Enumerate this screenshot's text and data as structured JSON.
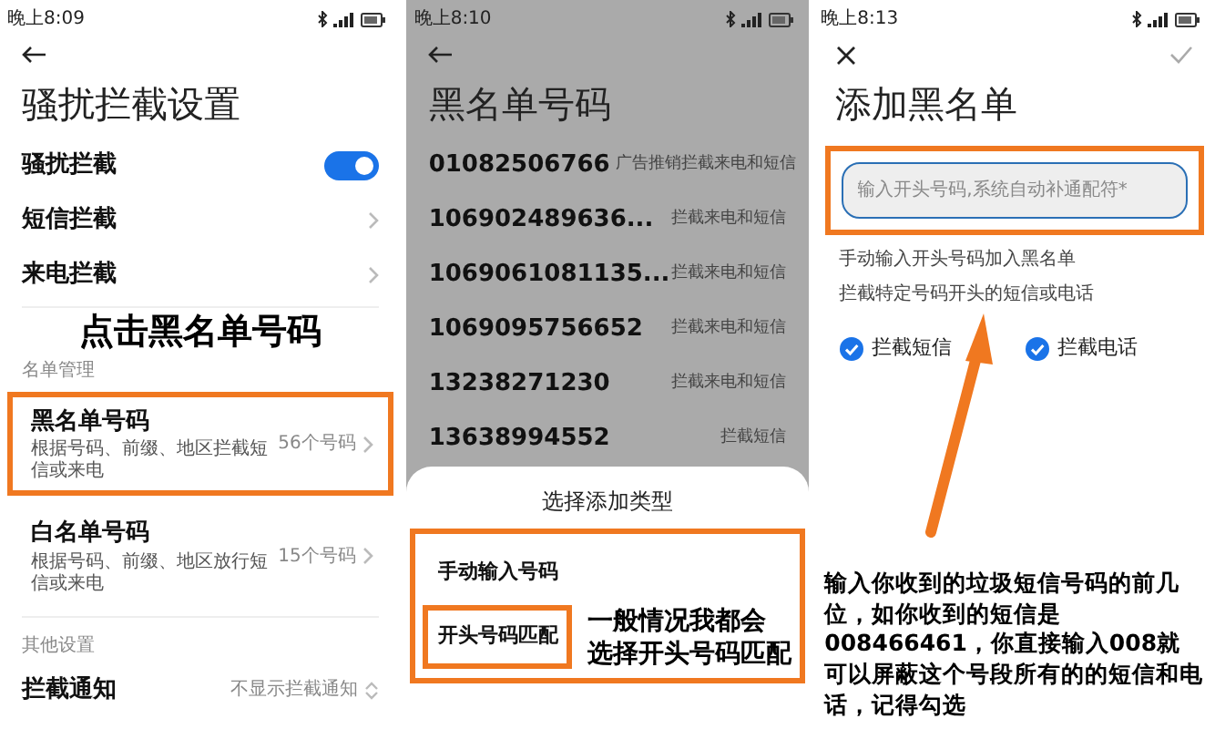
{
  "settings_screen": {
    "status_time": "晚上8:09",
    "title": "骚扰拦截设置",
    "rows": [
      {
        "kind": "toggle",
        "label": "骚扰拦截",
        "on": true
      },
      {
        "kind": "link",
        "label": "短信拦截"
      },
      {
        "kind": "link",
        "label": "来电拦截"
      }
    ],
    "annotation": "点击黑名单号码",
    "list_section": {
      "heading": "名单管理",
      "items": [
        {
          "label": "黑名单号码",
          "description": "根据号码、前缀、地区拦截短信或来电",
          "count": "56个号码",
          "highlighted": true
        },
        {
          "label": "白名单号码",
          "description": "根据号码、前缀、地区放行短信或来电",
          "count": "15个号码",
          "highlighted": false
        }
      ]
    },
    "other_section": {
      "heading": "其他设置",
      "items": [
        {
          "label": "拦截通知",
          "value": "不显示拦截通知"
        }
      ]
    }
  },
  "blacklist_screen": {
    "status_time": "晚上8:10",
    "title": "黑名单号码",
    "entries": [
      {
        "number": "01082506766",
        "tag": "广告推销",
        "action": "拦截来电和短信"
      },
      {
        "number": "106902489636...",
        "action": "拦截来电和短信"
      },
      {
        "number": "1069061081135...",
        "action": "拦截来电和短信"
      },
      {
        "number": "1069095756652",
        "action": "拦截来电和短信"
      },
      {
        "number": "13238271230",
        "action": "拦截来电和短信"
      },
      {
        "number": "13638994552",
        "action": "拦截短信"
      }
    ],
    "sheet": {
      "title": "选择添加类型",
      "framed": true,
      "options": [
        {
          "label": "手动输入号码",
          "highlighted": false
        },
        {
          "label": "开头号码匹配",
          "highlighted": true
        }
      ],
      "annotation": [
        "一般情况我都会",
        "选择开头号码匹配"
      ]
    }
  },
  "add_screen": {
    "status_time": "晚上8:13",
    "title": "添加黑名单",
    "input": {
      "placeholder": "输入开头号码,系统自动补通配符*",
      "highlighted": true
    },
    "hints": [
      "手动输入开头号码加入黑名单",
      "拦截特定号码开头的短信或电话"
    ],
    "checkboxes": [
      {
        "label": "拦截短信",
        "checked": true
      },
      {
        "label": "拦截电话",
        "checked": true
      }
    ],
    "annotation": "输入你收到的垃圾短信号码的前几位，如你收到的短信是008466461，你直接输入008就可以屏蔽这个号段所有的的短信和电话，记得勾选"
  }
}
